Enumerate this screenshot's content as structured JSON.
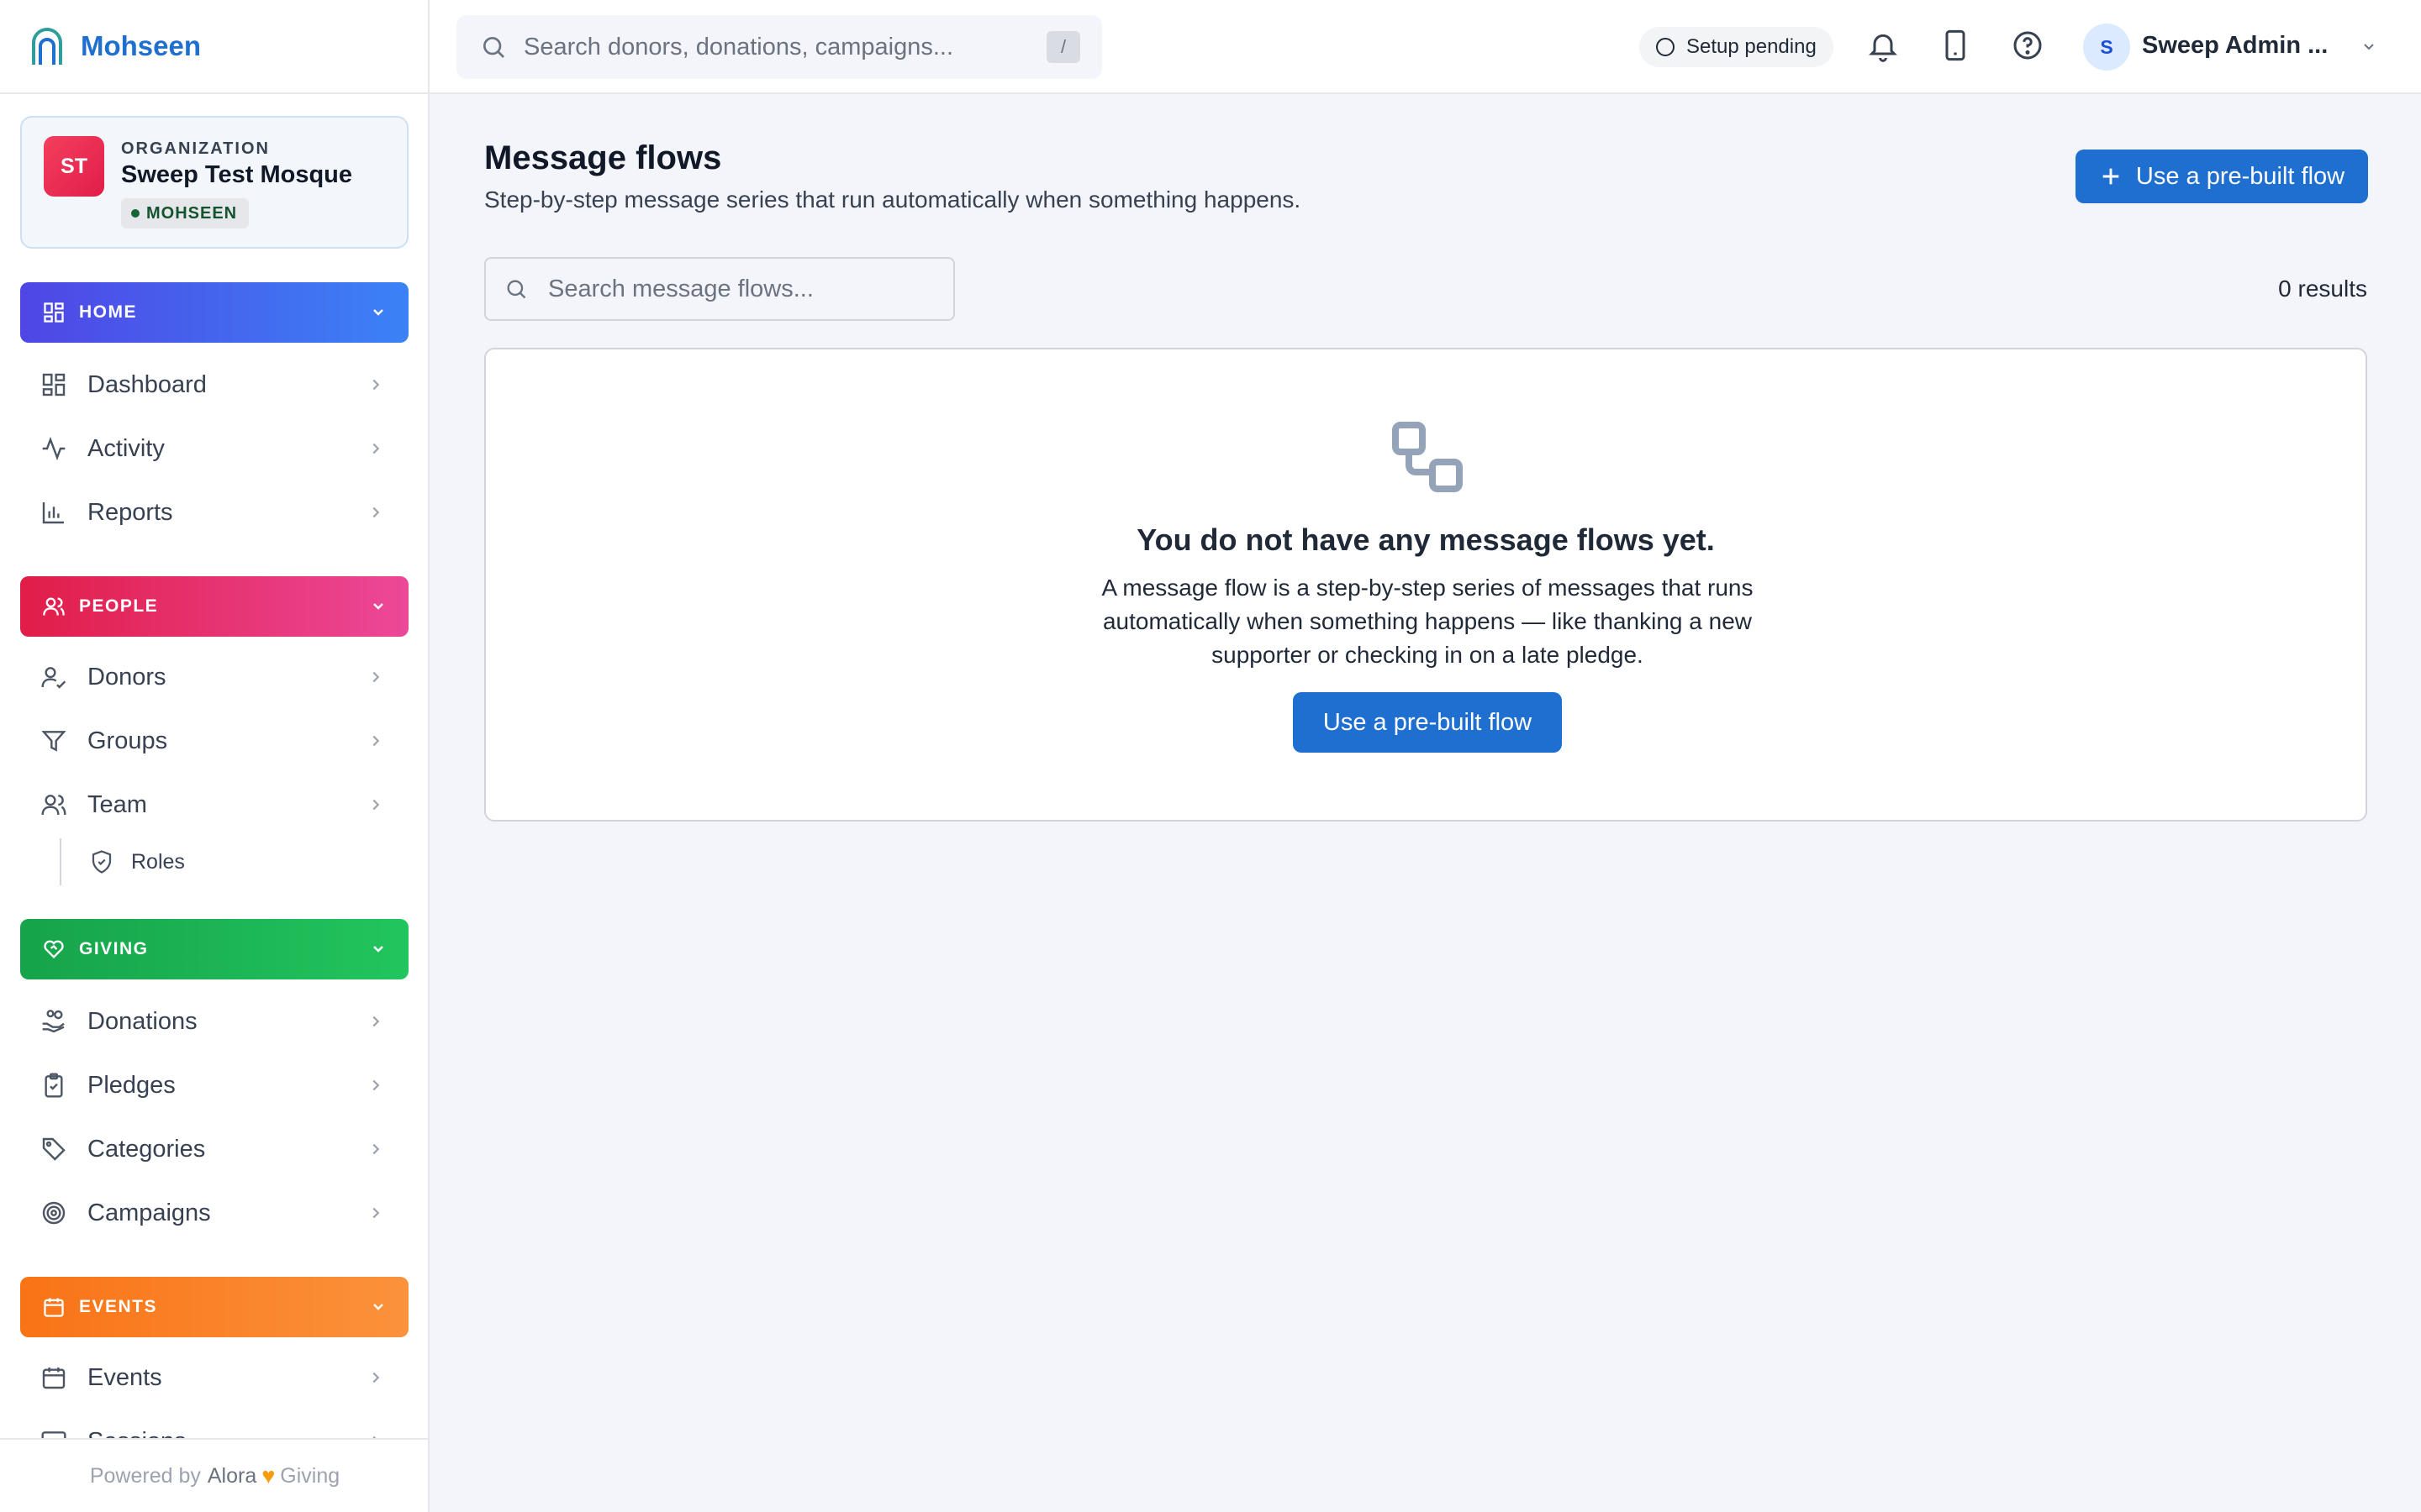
{
  "brand": {
    "name": "Mohseen"
  },
  "organization": {
    "label": "ORGANIZATION",
    "initials": "ST",
    "name": "Sweep Test Mosque",
    "badge": "MOHSEEN"
  },
  "sections": {
    "home": {
      "label": "HOME",
      "items": [
        {
          "label": "Dashboard"
        },
        {
          "label": "Activity"
        },
        {
          "label": "Reports"
        }
      ]
    },
    "people": {
      "label": "PEOPLE",
      "items": [
        {
          "label": "Donors"
        },
        {
          "label": "Groups"
        },
        {
          "label": "Team"
        }
      ],
      "subitems": [
        {
          "label": "Roles"
        }
      ]
    },
    "giving": {
      "label": "GIVING",
      "items": [
        {
          "label": "Donations"
        },
        {
          "label": "Pledges"
        },
        {
          "label": "Categories"
        },
        {
          "label": "Campaigns"
        }
      ]
    },
    "events": {
      "label": "EVENTS",
      "items": [
        {
          "label": "Events"
        },
        {
          "label": "Sessions"
        }
      ]
    }
  },
  "footer": {
    "prefix": "Powered by",
    "brand_a": "Alora",
    "brand_b": "Giving"
  },
  "topbar": {
    "search_placeholder": "Search donors, donations, campaigns...",
    "search_shortcut": "/",
    "setup_status": "Setup pending",
    "user_initial": "S",
    "user_name": "Sweep Admin ..."
  },
  "page": {
    "title": "Message flows",
    "subtitle": "Step-by-step message series that run automatically when something happens.",
    "primary_action": "Use a pre-built flow",
    "search_placeholder": "Search message flows...",
    "results": "0 results"
  },
  "empty_state": {
    "title": "You do not have any message flows yet.",
    "description": "A message flow is a step-by-step series of messages that runs automatically when something happens — like thanking a new supporter or checking in on a late pledge.",
    "action": "Use a pre-built flow"
  },
  "colors": {
    "accent": "#1f6fd1",
    "home": "#4f46e5",
    "people": "#e11d48",
    "giving": "#16a34a",
    "events": "#f97316"
  }
}
